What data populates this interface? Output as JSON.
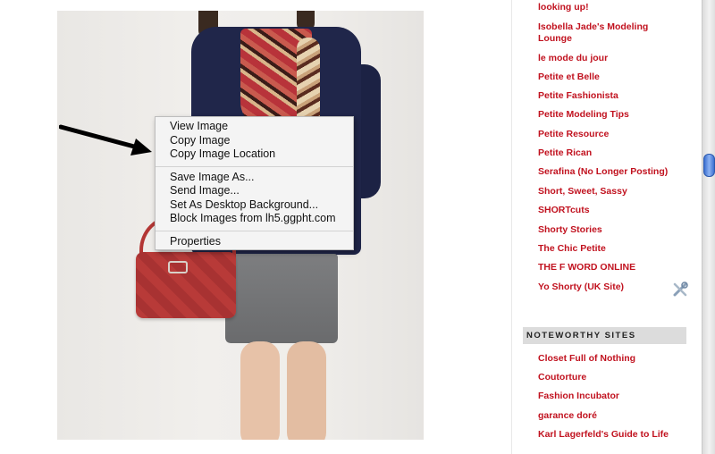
{
  "context_menu": {
    "items_group1": [
      "View Image",
      "Copy Image",
      "Copy Image Location"
    ],
    "items_group2": [
      "Save Image As...",
      "Send Image...",
      "Set As Desktop Background...",
      "Block Images from lh5.ggpht.com"
    ],
    "items_group3": [
      "Properties"
    ]
  },
  "sidebar": {
    "links": [
      "looking up!",
      "Isobella Jade's Modeling Lounge",
      "le mode du jour",
      "Petite et Belle",
      "Petite Fashionista",
      "Petite Modeling Tips",
      "Petite Resource",
      "Petite Rican",
      "Serafina (No Longer Posting)",
      "Short, Sweet, Sassy",
      "SHORTcuts",
      "Shorty Stories",
      "The Chic Petite",
      "THE F WORD ONLINE",
      "Yo Shorty (UK Site)"
    ],
    "section_title": "NOTEWORTHY SITES",
    "noteworthy_links": [
      "Closet Full of Nothing",
      "Coutorture",
      "Fashion Incubator",
      "garance doré",
      "Karl Lagerfeld's Guide to Life"
    ]
  },
  "colors": {
    "link": "#c1121f",
    "section_bg": "#dcdcdc",
    "scroll_thumb": "#3b6fd0"
  },
  "icons": {
    "annotation_arrow": "arrow-icon",
    "edit_widget": "tools-icon"
  }
}
